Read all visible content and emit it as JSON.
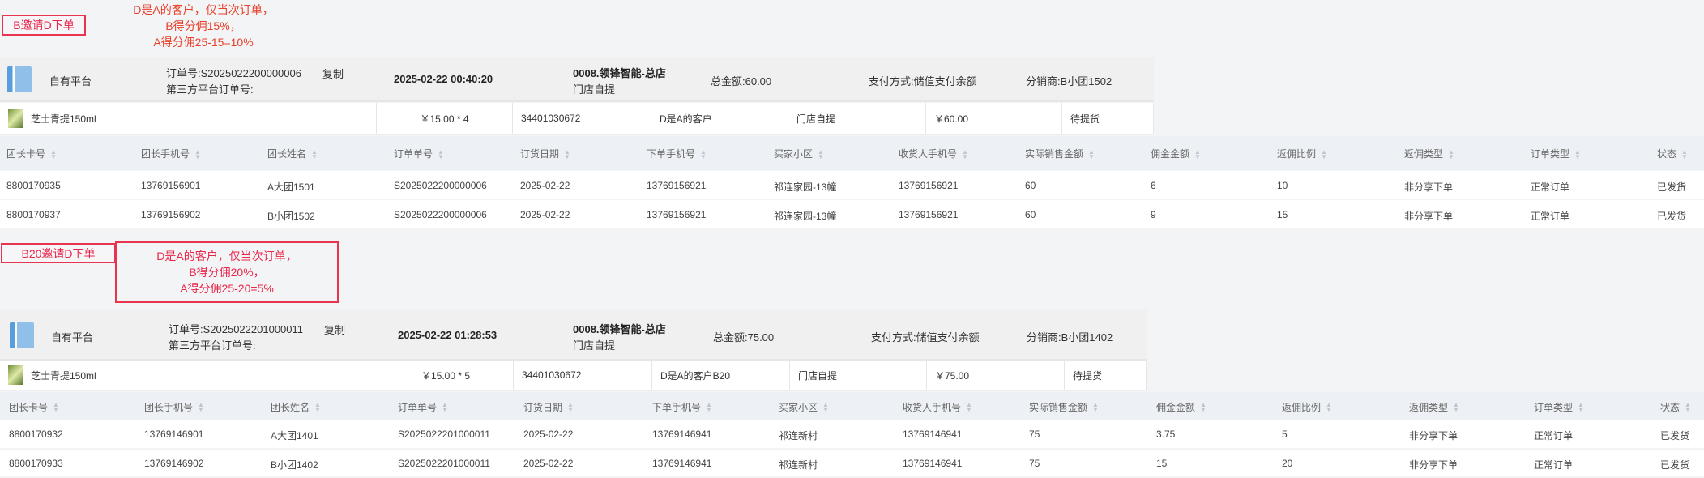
{
  "columns": [
    "团长卡号",
    "团长手机号",
    "团长姓名",
    "订单单号",
    "订货日期",
    "下单手机号",
    "买家小区",
    "收货人手机号",
    "实际销售金额",
    "佣金金额",
    "返佣比例",
    "返佣类型",
    "订单类型",
    "状态"
  ],
  "colors": {
    "note_red": "#e8264a",
    "anno_red_1": "#e8402a",
    "link_blue": "#3a8ee6",
    "table_header_bg": "#edf0f4"
  },
  "sections": [
    {
      "note_label": "B邀请D下单",
      "annotation": [
        "D是A的客户，仅当次订单，",
        "B得分佣15%，",
        "A得分佣25-15=10%"
      ],
      "order": {
        "platform": "自有平台",
        "order_no": "订单号:S2025022200000006",
        "copy_label": "复制",
        "third_party_label": "第三方平台订单号:",
        "datetime": "2025-02-22 00:40:20",
        "store": "0008.领锋智能-总店",
        "delivery": "门店自提",
        "total": "总金额:60.00",
        "payment": "支付方式:储值支付余额",
        "distributor": "分销商:B小团1502"
      },
      "product": {
        "name": "芝士青提150ml",
        "price_qty": "￥15.00 * 4",
        "code": "34401030672",
        "remark": "D是A的客户",
        "pickup": "门店自提",
        "amount": "￥60.00",
        "status": "待提货"
      },
      "rows": [
        [
          "8800170935",
          "13769156901",
          "A大团1501",
          "S2025022200000006",
          "2025-02-22",
          "13769156921",
          "祁连家园-13幢",
          "13769156921",
          "60",
          "6",
          "10",
          "非分享下单",
          "正常订单",
          "已发货"
        ],
        [
          "8800170937",
          "13769156902",
          "B小团1502",
          "S2025022200000006",
          "2025-02-22",
          "13769156921",
          "祁连家园-13幢",
          "13769156921",
          "60",
          "9",
          "15",
          "非分享下单",
          "正常订单",
          "已发货"
        ]
      ]
    },
    {
      "note_label": "B20邀请D下单",
      "annotation": [
        "D是A的客户，仅当次订单，",
        "B得分佣20%，",
        "A得分佣25-20=5%"
      ],
      "order": {
        "platform": "自有平台",
        "order_no": "订单号:S2025022201000011",
        "copy_label": "复制",
        "third_party_label": "第三方平台订单号:",
        "datetime": "2025-02-22 01:28:53",
        "store": "0008.领锋智能-总店",
        "delivery": "门店自提",
        "total": "总金额:75.00",
        "payment": "支付方式:储值支付余额",
        "distributor": "分销商:B小团1402"
      },
      "product": {
        "name": "芝士青提150ml",
        "price_qty": "￥15.00 * 5",
        "code": "34401030672",
        "remark": "D是A的客户B20",
        "pickup": "门店自提",
        "amount": "￥75.00",
        "status": "待提货"
      },
      "rows": [
        [
          "8800170932",
          "13769146901",
          "A大团1401",
          "S2025022201000011",
          "2025-02-22",
          "13769146941",
          "祁连新村",
          "13769146941",
          "75",
          "3.75",
          "5",
          "非分享下单",
          "正常订单",
          "已发货"
        ],
        [
          "8800170933",
          "13769146902",
          "B小团1402",
          "S2025022201000011",
          "2025-02-22",
          "13769146941",
          "祁连新村",
          "13769146941",
          "75",
          "15",
          "20",
          "非分享下单",
          "正常订单",
          "已发货"
        ]
      ]
    }
  ]
}
